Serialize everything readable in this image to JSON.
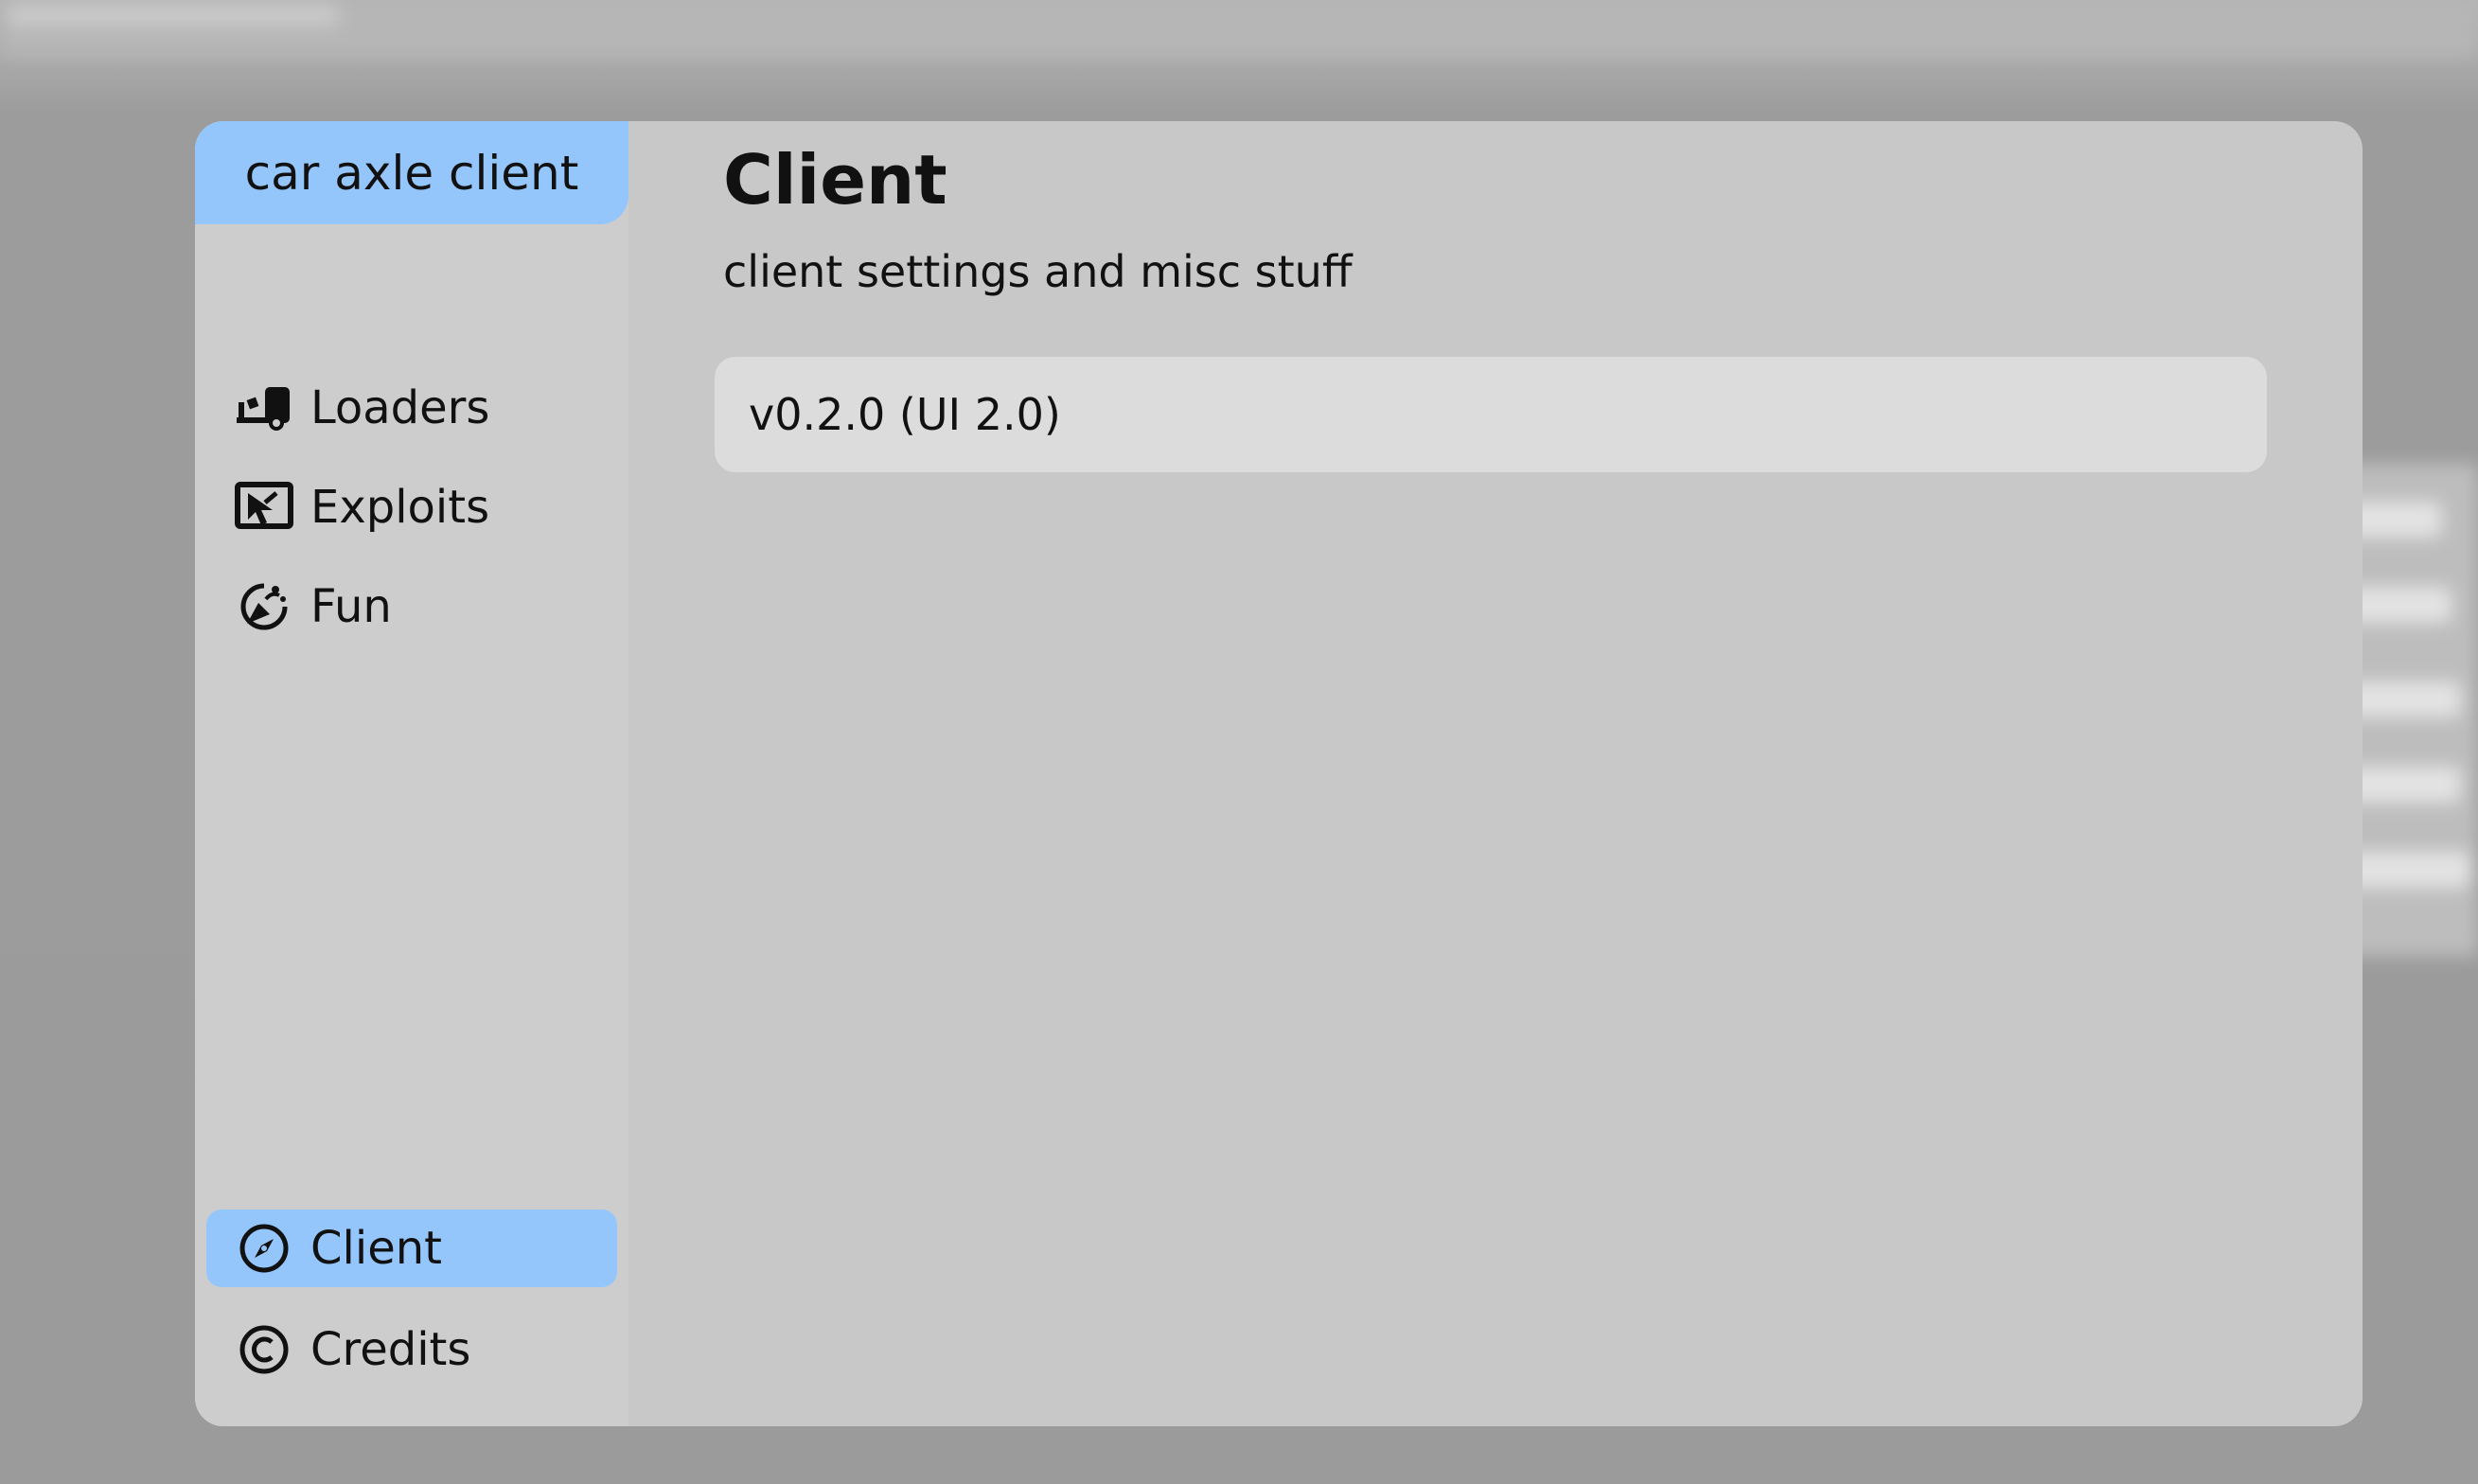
{
  "app": {
    "brand": "car axle client"
  },
  "sidebar": {
    "items": [
      {
        "label": "Loaders",
        "icon": "forklift-icon"
      },
      {
        "label": "Exploits",
        "icon": "cursor-screen-icon"
      },
      {
        "label": "Fun",
        "icon": "party-icon"
      }
    ],
    "bottom_items": [
      {
        "label": "Client",
        "icon": "compass-icon",
        "active": true
      },
      {
        "label": "Credits",
        "icon": "copyright-icon",
        "active": false
      }
    ]
  },
  "main": {
    "title": "Client",
    "subtitle": "client settings and misc stuff",
    "version": "v0.2.0 (UI 2.0)"
  },
  "colors": {
    "accent": "#95c6fb",
    "window_bg": "#c8c8c8",
    "sidebar_bg": "#cdcdcd",
    "card_bg": "#dcdcdc"
  }
}
